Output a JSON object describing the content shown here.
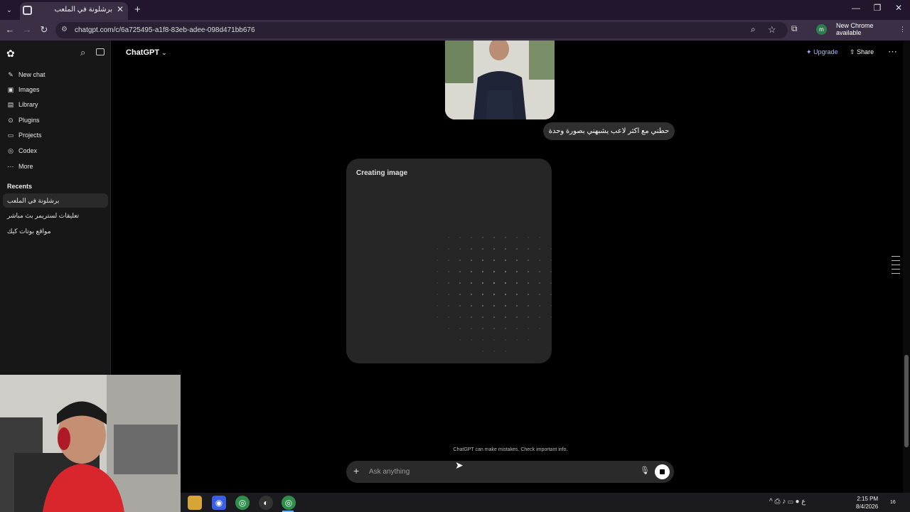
{
  "browser": {
    "tab_title": "برشلونة في الملعب",
    "url": "chatgpt.com/c/6a725495-a1f8-83eb-adee-098d471bb676",
    "update_label": "New Chrome available",
    "profile_initial": "m"
  },
  "sidebar": {
    "items": [
      {
        "label": "New chat",
        "icon": "edit-icon"
      },
      {
        "label": "Images",
        "icon": "image-icon"
      },
      {
        "label": "Library",
        "icon": "library-icon"
      },
      {
        "label": "Plugins",
        "icon": "plugins-icon"
      },
      {
        "label": "Projects",
        "icon": "folder-icon"
      },
      {
        "label": "Codex",
        "icon": "codex-icon"
      },
      {
        "label": "More",
        "icon": "more-icon"
      }
    ],
    "recents_heading": "Recents",
    "recents": [
      "برشلونة في الملعب",
      "تعليقات لستريمر بث مباشر",
      "مواقع بوتات كيك"
    ]
  },
  "header": {
    "model": "ChatGPT",
    "upgrade": "Upgrade",
    "share": "Share"
  },
  "conversation": {
    "user_message": "حطني مع اكثر لاعب يشبهني بصورة وحدة",
    "generating_label": "Creating image"
  },
  "composer": {
    "placeholder": "Ask anything",
    "disclaimer": "ChatGPT can make mistakes. Check important info."
  },
  "taskbar": {
    "time": "2:15 PM",
    "date": "8/4/2026",
    "lang": "ع",
    "notif_count": "16"
  }
}
